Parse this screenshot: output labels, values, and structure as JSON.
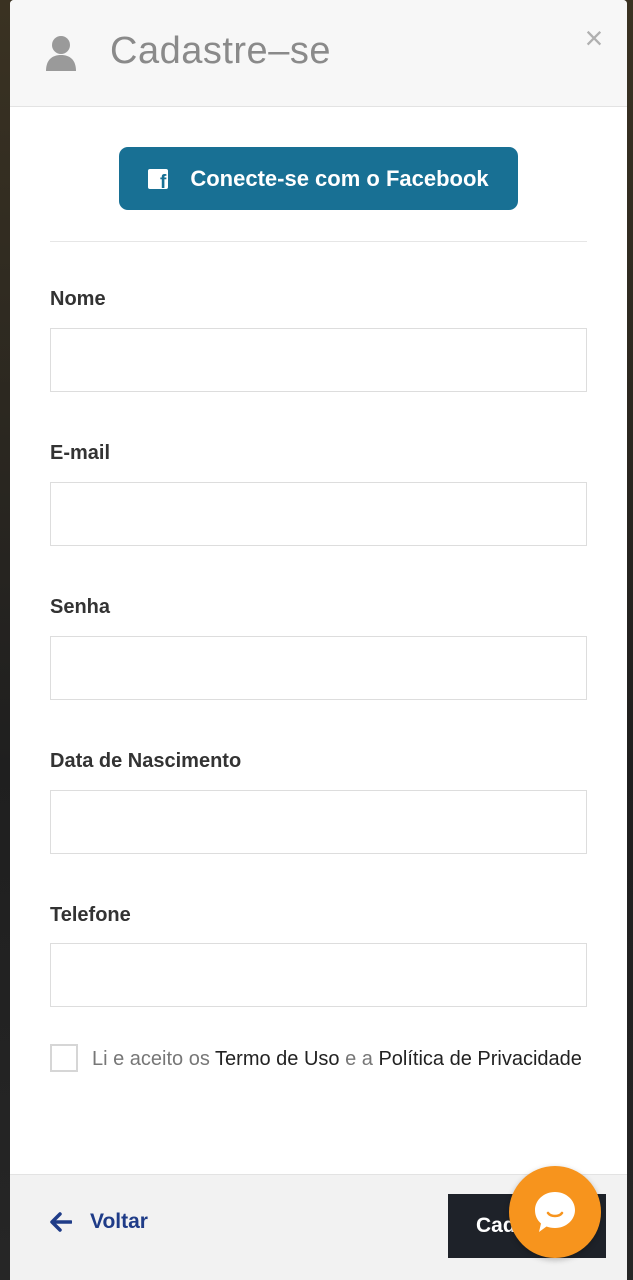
{
  "header": {
    "title": "Cadastre–se",
    "close_label": "×"
  },
  "facebook": {
    "label": "Conecte-se com o Facebook",
    "icon_letter": "f"
  },
  "form": {
    "fields": [
      {
        "label": "Nome",
        "value": "",
        "placeholder": ""
      },
      {
        "label": "E-mail",
        "value": "",
        "placeholder": ""
      },
      {
        "label": "Senha",
        "value": "",
        "placeholder": ""
      },
      {
        "label": "Data de Nascimento",
        "value": "",
        "placeholder": ""
      },
      {
        "label": "Telefone",
        "value": "",
        "placeholder": ""
      }
    ],
    "terms": {
      "checked": false,
      "prefix": "Li e aceito os ",
      "terms_link": "Termo de Uso",
      "middle": " e a ",
      "privacy_link": "Política de Privacidade"
    }
  },
  "footer": {
    "back_label": "Voltar",
    "submit_label": "Cadastrar"
  },
  "colors": {
    "facebook_button": "#187094",
    "back_link": "#1f3c88",
    "submit_button": "#1e2229",
    "chat_bubble": "#f7941d"
  },
  "icons": {
    "header": "user-icon",
    "close": "close-icon",
    "facebook": "facebook-icon",
    "back": "arrow-left-icon",
    "chat": "chat-icon"
  }
}
